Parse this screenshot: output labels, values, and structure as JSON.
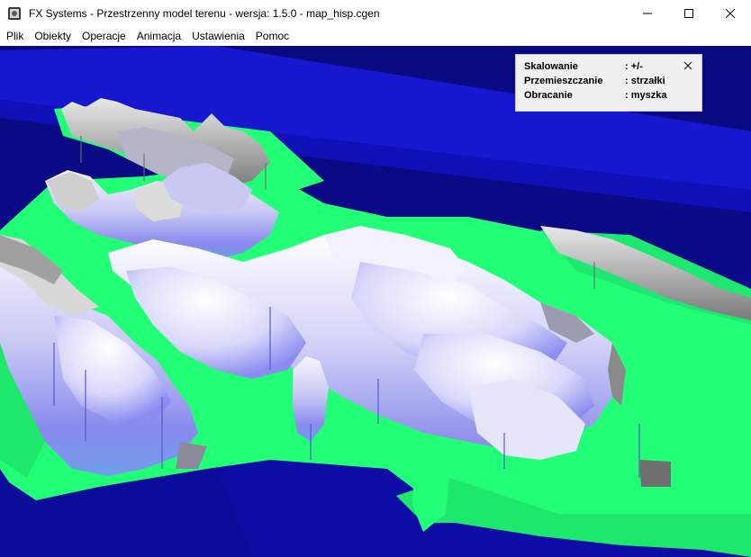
{
  "window": {
    "title": "FX Systems - Przestrzenny model terenu - wersja: 1.5.0 - map_hisp.cgen",
    "app_icon": "app-icon",
    "controls": [
      "minimize-icon",
      "maximize-icon",
      "close-icon"
    ]
  },
  "menu": {
    "items": [
      "Plik",
      "Obiekty",
      "Operacje",
      "Animacja",
      "Ustawienia",
      "Pomoc"
    ]
  },
  "info_panel": {
    "rows": [
      {
        "key": "Skalowanie",
        "value": ": +/-"
      },
      {
        "key": "Przemieszczanie",
        "value": ": strzałki"
      },
      {
        "key": "Obracanie",
        "value": ": myszka"
      }
    ],
    "close_icon": "close-icon"
  },
  "terrain_colors": {
    "deep_water": "#0b0b8a",
    "shallow_water": "#1a1ad2",
    "lowland": "#22ff77",
    "upland": "#8c8cf0",
    "peak": "#f4f4ff",
    "ridge": "#8c8c8c"
  }
}
